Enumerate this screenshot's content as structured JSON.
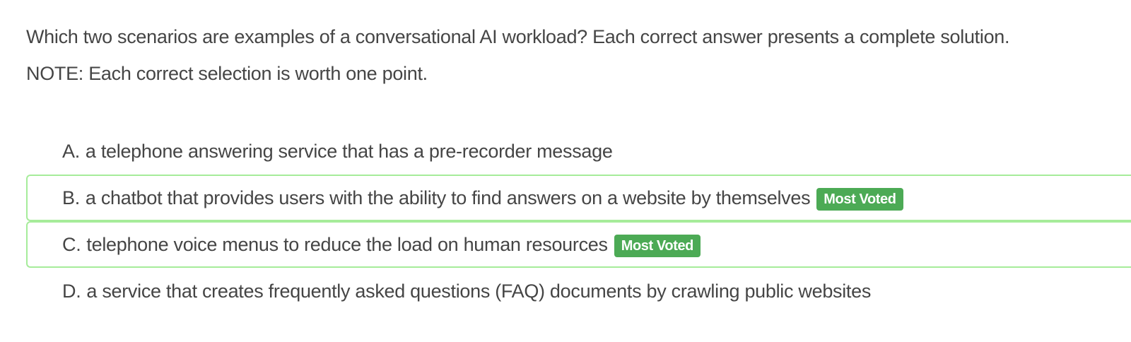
{
  "question": {
    "line1": "Which two scenarios are examples of a conversational AI workload? Each correct answer presents a complete solution.",
    "line2": "NOTE: Each correct selection is worth one point."
  },
  "choices": [
    {
      "letter": "A.",
      "text": "a telephone answering service that has a pre-recorder message",
      "badge": ""
    },
    {
      "letter": "B.",
      "text": "a chatbot that provides users with the ability to find answers on a website by themselves",
      "badge": "Most Voted"
    },
    {
      "letter": "C.",
      "text": "telephone voice menus to reduce the load on human resources",
      "badge": "Most Voted"
    },
    {
      "letter": "D.",
      "text": "a service that creates frequently asked questions (FAQ) documents by crawling public websites",
      "badge": ""
    }
  ],
  "colors": {
    "text": "#454545",
    "highlight_border": "#a6ec9a",
    "badge_bg": "#4caa55",
    "badge_text": "#ffffff"
  }
}
